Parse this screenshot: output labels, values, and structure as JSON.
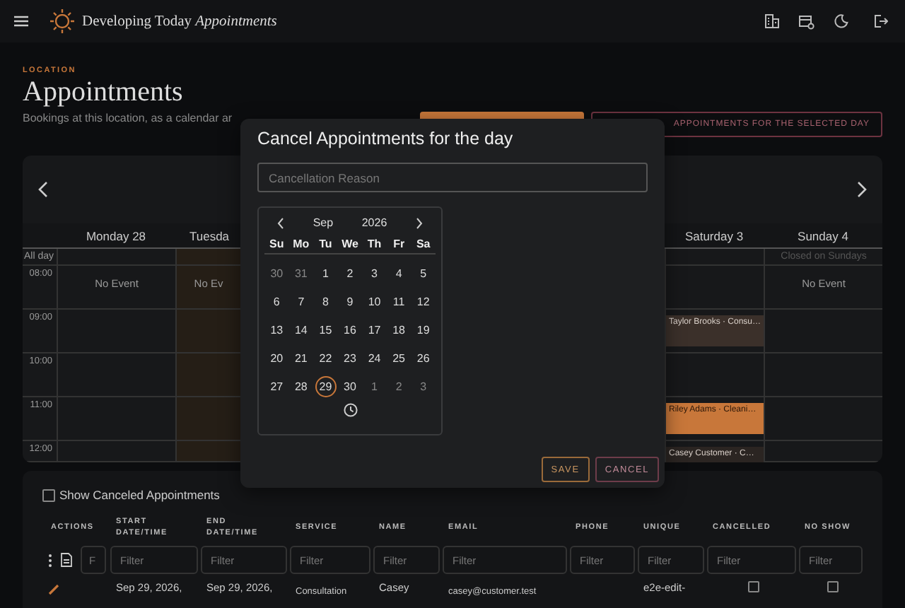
{
  "navbar": {
    "brand": "Developing Today",
    "brand_italic": "Appointments"
  },
  "header": {
    "eyebrow": "LOCATION",
    "title": "Appointments",
    "subtitle": "Bookings at this location, as a calendar ar",
    "cancel_day_button": "APPOINTMENTS FOR THE SELECTED DAY"
  },
  "calendar": {
    "all_day_label": "All day",
    "days": [
      {
        "label": "Monday 28",
        "selected": false
      },
      {
        "label": "Tuesda",
        "selected": true
      },
      {
        "label": "Saturday 3",
        "selected": false
      },
      {
        "label": "Sunday 4",
        "selected": false,
        "all_day": "Closed on Sundays"
      }
    ],
    "rows": [
      {
        "time": "08:00",
        "cells": [
          {
            "kind": "note",
            "text": "No Event"
          },
          {
            "kind": "note",
            "text": "No Ev"
          },
          {
            "kind": "blank"
          },
          {
            "kind": "note",
            "text": "No Event"
          }
        ]
      },
      {
        "time": "09:00",
        "cells": [
          {
            "kind": "blank"
          },
          {
            "kind": "blank"
          },
          {
            "kind": "event",
            "text": "Taylor Brooks · Consu…",
            "color": "#3b302a"
          },
          {
            "kind": "blank"
          }
        ]
      },
      {
        "time": "10:00",
        "cells": [
          {
            "kind": "blank"
          },
          {
            "kind": "blank"
          },
          {
            "kind": "blank"
          },
          {
            "kind": "blank"
          }
        ]
      },
      {
        "time": "11:00",
        "cells": [
          {
            "kind": "blank"
          },
          {
            "kind": "blank"
          },
          {
            "kind": "event",
            "text": "Riley Adams · Cleani…",
            "color": "#c8773a"
          },
          {
            "kind": "blank"
          }
        ]
      },
      {
        "time": "12:00",
        "cells": [
          {
            "kind": "blank"
          },
          {
            "kind": "blank"
          },
          {
            "kind": "event",
            "text": "Casey Customer · C…",
            "color": "#2b2522"
          },
          {
            "kind": "blank"
          }
        ]
      }
    ]
  },
  "dialog": {
    "title": "Cancel Appointments for the day",
    "reason_placeholder": "Cancellation Reason",
    "picker": {
      "month": "Sep",
      "year": "2026",
      "weekdays": [
        "Su",
        "Mo",
        "Tu",
        "We",
        "Th",
        "Fr",
        "Sa"
      ],
      "dates": [
        {
          "text": "30",
          "outside": true,
          "selected": false
        },
        {
          "text": "31",
          "outside": true,
          "selected": false
        },
        {
          "text": "1",
          "outside": false,
          "selected": false
        },
        {
          "text": "2",
          "outside": false,
          "selected": false
        },
        {
          "text": "3",
          "outside": false,
          "selected": false
        },
        {
          "text": "4",
          "outside": false,
          "selected": false
        },
        {
          "text": "5",
          "outside": false,
          "selected": false
        },
        {
          "text": "6",
          "outside": false,
          "selected": false
        },
        {
          "text": "7",
          "outside": false,
          "selected": false
        },
        {
          "text": "8",
          "outside": false,
          "selected": false
        },
        {
          "text": "9",
          "outside": false,
          "selected": false
        },
        {
          "text": "10",
          "outside": false,
          "selected": false
        },
        {
          "text": "11",
          "outside": false,
          "selected": false
        },
        {
          "text": "12",
          "outside": false,
          "selected": false
        },
        {
          "text": "13",
          "outside": false,
          "selected": false
        },
        {
          "text": "14",
          "outside": false,
          "selected": false
        },
        {
          "text": "15",
          "outside": false,
          "selected": false
        },
        {
          "text": "16",
          "outside": false,
          "selected": false
        },
        {
          "text": "17",
          "outside": false,
          "selected": false
        },
        {
          "text": "18",
          "outside": false,
          "selected": false
        },
        {
          "text": "19",
          "outside": false,
          "selected": false
        },
        {
          "text": "20",
          "outside": false,
          "selected": false
        },
        {
          "text": "21",
          "outside": false,
          "selected": false
        },
        {
          "text": "22",
          "outside": false,
          "selected": false
        },
        {
          "text": "23",
          "outside": false,
          "selected": false
        },
        {
          "text": "24",
          "outside": false,
          "selected": false
        },
        {
          "text": "25",
          "outside": false,
          "selected": false
        },
        {
          "text": "26",
          "outside": false,
          "selected": false
        },
        {
          "text": "27",
          "outside": false,
          "selected": false
        },
        {
          "text": "28",
          "outside": false,
          "selected": false
        },
        {
          "text": "29",
          "outside": false,
          "selected": true
        },
        {
          "text": "30",
          "outside": false,
          "selected": false
        },
        {
          "text": "1",
          "outside": true,
          "selected": false
        },
        {
          "text": "2",
          "outside": true,
          "selected": false
        },
        {
          "text": "3",
          "outside": true,
          "selected": false
        }
      ]
    },
    "buttons": [
      "SAVE",
      "CANCEL"
    ]
  },
  "table": {
    "show_canceled": {
      "label": "Show Canceled Appointments",
      "checked": false
    },
    "columns": [
      "ACTIONS",
      "START DATE/TIME",
      "END DATE/TIME",
      "SERVICE",
      "NAME",
      "EMAIL",
      "PHONE",
      "UNIQUE",
      "CANCELLED",
      "NO SHOW"
    ],
    "action_filter_placeholder": "F",
    "filter_placeholders": [
      "Filter",
      "Filter",
      "Filter",
      "Filter",
      "Filter",
      "Filter",
      "Filter",
      "Filter",
      "Filter"
    ],
    "rows": [
      {
        "start": "Sep 29, 2026,",
        "end": "Sep 29, 2026,",
        "service": "Consultation",
        "name": "Casey",
        "email": "casey@customer.test",
        "unique": "e2e-edit-",
        "cancelled": false,
        "no_show": false
      }
    ]
  }
}
